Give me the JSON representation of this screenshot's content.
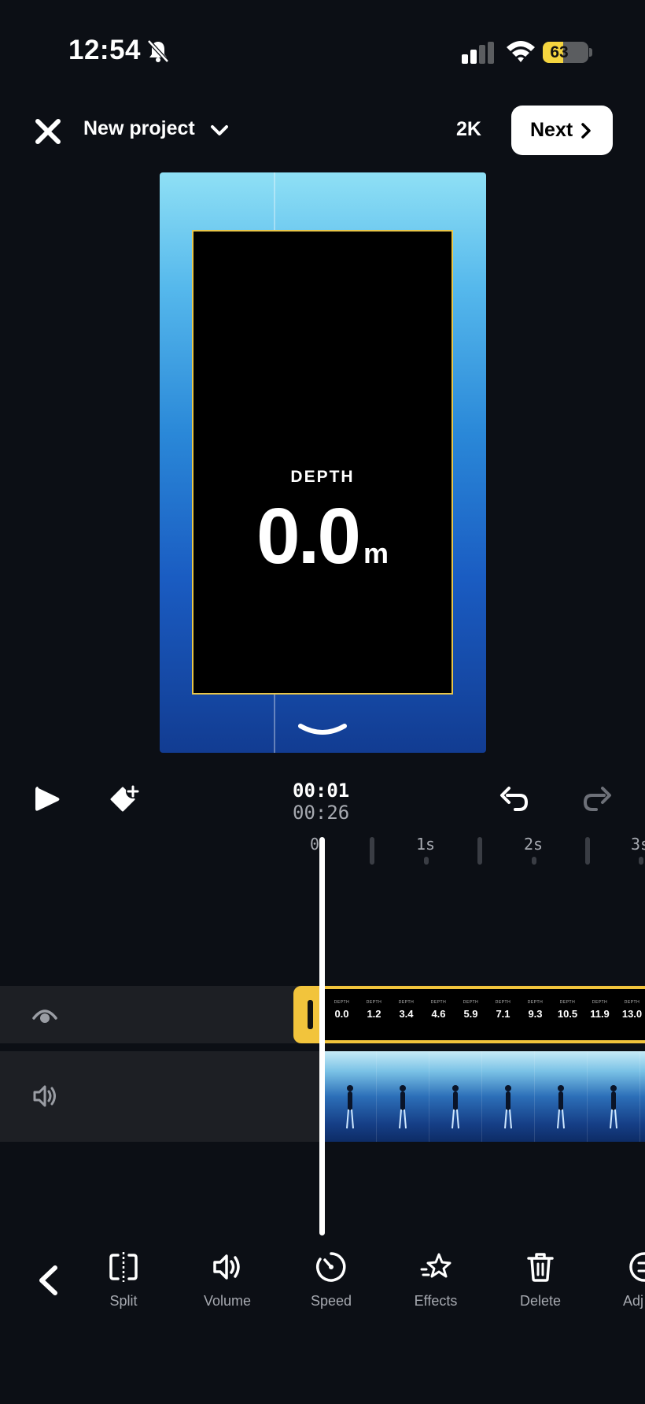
{
  "status_bar": {
    "time": "12:54",
    "battery": "63",
    "battery_level": 0.63
  },
  "header": {
    "title": "New project",
    "quality": "2K",
    "next_label": "Next"
  },
  "preview": {
    "overlay_label": "DEPTH",
    "overlay_value": "0.0",
    "overlay_unit": "m"
  },
  "playback": {
    "current_time": "00:01",
    "total_time": "00:26"
  },
  "ruler": {
    "labels": [
      "0",
      "1s",
      "2s",
      "3s"
    ]
  },
  "overlay_track": {
    "thumb_label": "DEPTH",
    "thumbnails": [
      "0.0",
      "1.2",
      "3.4",
      "4.6",
      "5.9",
      "7.1",
      "9.3",
      "10.5",
      "11.9",
      "13.0"
    ]
  },
  "toolbar": {
    "tools": [
      {
        "label": "Split",
        "icon": "split-icon"
      },
      {
        "label": "Volume",
        "icon": "volume-icon"
      },
      {
        "label": "Speed",
        "icon": "speed-icon"
      },
      {
        "label": "Effects",
        "icon": "effects-icon"
      },
      {
        "label": "Delete",
        "icon": "delete-icon"
      },
      {
        "label": "Adj",
        "icon": "adjust-icon"
      }
    ]
  },
  "colors": {
    "accent": "#f2c43c",
    "background": "#0c0f15",
    "track": "#1d1f24"
  }
}
